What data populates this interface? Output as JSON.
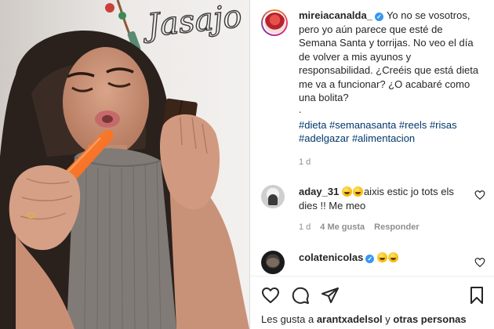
{
  "post": {
    "username": "mireiacanalda_",
    "verified_icon": "verified-badge-icon",
    "caption_text": "Yo no se vosotros, pero yo aún parece que esté de Semana Santa y torrijas. No veo el día de volver a mis ayunos y responsabilidad. ¿Creéis que está dieta me va a funcionar? ¿O acabaré como una bolita?",
    "caption_dot": ".",
    "hashtags": "#dieta #semanasanta #reels #risas #adelgazar #alimentacion",
    "time": "1 d"
  },
  "comments": [
    {
      "username": "aday_31",
      "text": "aixis estic jo tots els dies !! Me meo",
      "emoji_count": 2,
      "time": "1 d",
      "likes": "4 Me gusta",
      "reply": "Responder"
    },
    {
      "username": "colatenicolas",
      "verified": true,
      "emoji_count": 2
    }
  ],
  "actions": {
    "icons": [
      "heart-icon",
      "comment-icon",
      "share-icon",
      "bookmark-icon"
    ],
    "likes_prefix": "Les gusta a ",
    "likes_user": "arantxadelsol",
    "likes_middle": " y ",
    "likes_others": "otras personas"
  },
  "media": {
    "wall_text": "Jasajo"
  },
  "colors": {
    "link": "#00376b",
    "verified": "#3897f0",
    "meta": "#8e8e8e",
    "text": "#262626"
  }
}
